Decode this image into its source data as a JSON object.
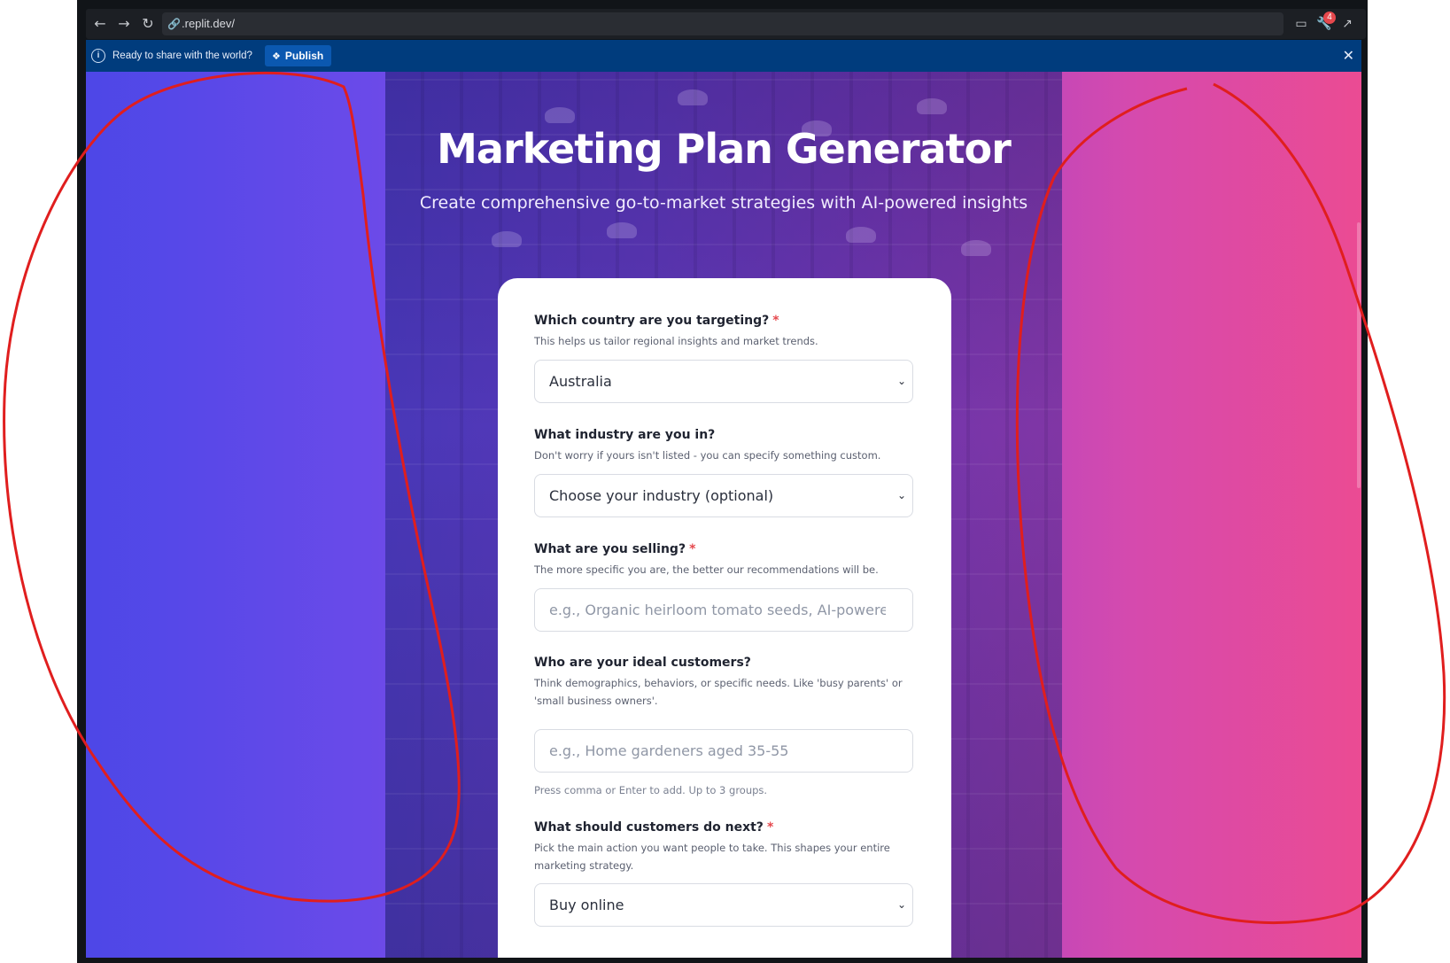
{
  "browser": {
    "url": ".replit.dev/",
    "badge_count": "4"
  },
  "publish_bar": {
    "message": "Ready to share with the world?",
    "button_label": "Publish"
  },
  "hero": {
    "title": "Marketing Plan Generator",
    "subtitle": "Create comprehensive go-to-market strategies with AI-powered insights"
  },
  "form": {
    "country": {
      "label": "Which country are you targeting?",
      "required_mark": "*",
      "help": "This helps us tailor regional insights and market trends.",
      "value": "Australia"
    },
    "industry": {
      "label": "What industry are you in?",
      "help": "Don't worry if yours isn't listed - you can specify something custom.",
      "value": "Choose your industry (optional)"
    },
    "product": {
      "label": "What are you selling?",
      "required_mark": "*",
      "help": "The more specific you are, the better our recommendations will be.",
      "placeholder": "e.g., Organic heirloom tomato seeds, AI-powered"
    },
    "customers": {
      "label": "Who are your ideal customers?",
      "help": "Think demographics, behaviors, or specific needs. Like 'busy parents' or 'small business owners'.",
      "placeholder": "e.g., Home gardeners aged 35-55",
      "hint": "Press comma or Enter to add. Up to 3 groups."
    },
    "action": {
      "label": "What should customers do next?",
      "required_mark": "*",
      "help": "Pick the main action you want people to take. This shapes your entire marketing strategy.",
      "value": "Buy online"
    }
  },
  "colors": {
    "gradient_left": "#4d47e7",
    "gradient_right": "#eb4b93",
    "publish_bar": "#003c7d",
    "required": "#e5484d"
  },
  "icons": [
    "back-arrow-icon",
    "forward-arrow-icon",
    "reload-icon",
    "link-icon",
    "devices-icon",
    "wrench-icon",
    "external-link-icon",
    "info-icon",
    "publish-icon",
    "close-icon",
    "chevron-down-icon"
  ]
}
